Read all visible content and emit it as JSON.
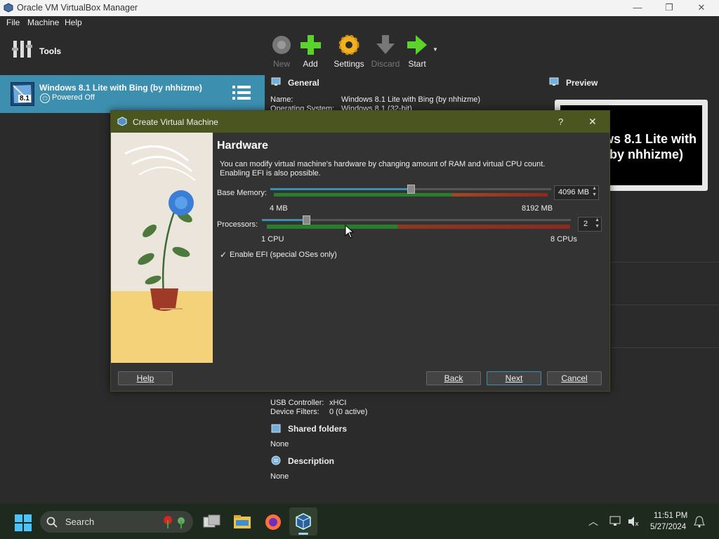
{
  "window": {
    "title": "Oracle VM VirtualBox Manager"
  },
  "menu": {
    "file": "File",
    "machine": "Machine",
    "help": "Help"
  },
  "left": {
    "tools_label": "Tools",
    "vm_name": "Windows 8.1 Lite with Bing (by nhhizme)",
    "vm_status": "Powered Off",
    "vm_badge": "8.1"
  },
  "toolbar": {
    "new": "New",
    "add": "Add",
    "settings": "Settings",
    "discard": "Discard",
    "start": "Start"
  },
  "details": {
    "general_title": "General",
    "name_label": "Name:",
    "name_value": "Windows 8.1 Lite with Bing (by nhhizme)",
    "os_label": "Operating System:",
    "os_value": "Windows 8.1 (32-bit)",
    "usb_label": "USB Controller:",
    "usb_value": "xHCI",
    "filters_label": "Device Filters:",
    "filters_value": "0 (0 active)",
    "shared_title": "Shared folders",
    "shared_value": "None",
    "desc_title": "Description",
    "desc_value": "None"
  },
  "preview": {
    "title": "Preview",
    "line1": "ws 8.1 Lite with",
    "line2": "by nhhizme)"
  },
  "dialog": {
    "title": "Create Virtual Machine",
    "help_q": "?",
    "close": "✕",
    "heading": "Hardware",
    "desc_line1": "You can modify virtual machine's hardware by changing amount of RAM and virtual CPU count.",
    "desc_line2": "Enabling EFI is also possible.",
    "memory_label": "Base Memory:",
    "memory_value": "4096 MB",
    "memory_min": "4 MB",
    "memory_max": "8192 MB",
    "memory_fraction": 0.5,
    "cpu_label": "Processors:",
    "cpu_value": "2",
    "cpu_min": "1 CPU",
    "cpu_max": "8 CPUs",
    "cpu_fraction": 0.143,
    "efi_check": "✓",
    "efi_label": "Enable EFI (special OSes only)",
    "btn_help": "Help",
    "btn_back": "Back",
    "btn_next": "Next",
    "btn_cancel": "Cancel"
  },
  "taskbar": {
    "search": "Search",
    "time": "11:51 PM",
    "date": "5/27/2024"
  }
}
